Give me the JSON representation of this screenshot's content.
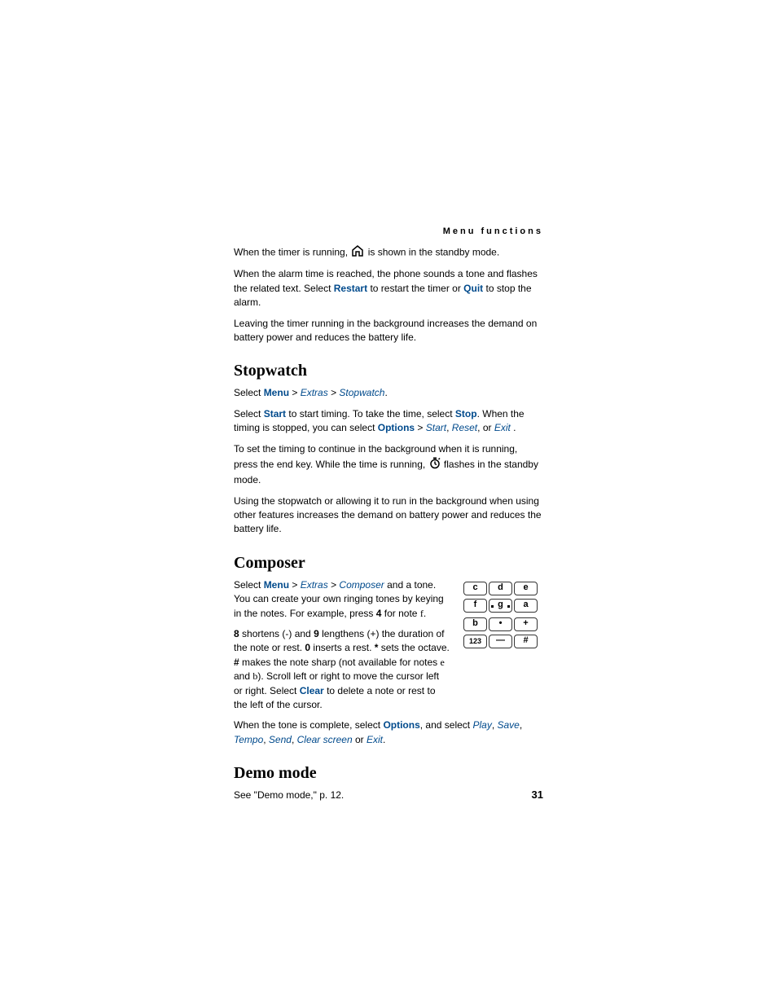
{
  "header": "Menu functions",
  "p1_a": "When the timer is running, ",
  "p1_b": " is shown in the standby mode.",
  "p2_a": "When the alarm time is reached, the phone sounds a tone and flashes the related text. Select ",
  "p2_restart": "Restart",
  "p2_b": " to restart the timer or ",
  "p2_quit": "Quit",
  "p2_c": " to stop the alarm.",
  "p3": "Leaving the timer running in the background increases the demand on battery power and reduces the battery life.",
  "h_stopwatch": "Stopwatch",
  "sw1_a": "Select ",
  "sw1_menu": "Menu",
  "sw1_gt1": " > ",
  "sw1_extras": "Extras",
  "sw1_gt2": " > ",
  "sw1_stopwatch": "Stopwatch",
  "sw1_period": ".",
  "sw2_a": "Select ",
  "sw2_start": "Start",
  "sw2_b": " to start timing. To take the time, select ",
  "sw2_stop": "Stop",
  "sw2_c": ". When the timing is stopped, you can select ",
  "sw2_options": "Options",
  "sw2_gt": " > ",
  "sw2_startit": "Start",
  "sw2_reset": "Reset",
  "sw2_exit": "Exit",
  "sw2_comma1": ", ",
  "sw2_or": ", or ",
  "sw2_space_period": " .",
  "sw3_a": "To set the timing to continue in the background when it is running, press the end key. While the time is running, ",
  "sw3_b": " flashes in the standby mode.",
  "sw4": "Using the stopwatch or allowing it to run in the background when using other features increases the demand on battery power and reduces the battery life.",
  "h_composer": "Composer",
  "c1_a": "Select ",
  "c1_menu": "Menu",
  "c1_gt1": " > ",
  "c1_extras": "Extras",
  "c1_gt2": " > ",
  "c1_composer": "Composer",
  "c1_b": " and a tone. You can create your own ringing tones by keying in the notes. For example, press ",
  "c1_4": "4",
  "c1_c": " for note ",
  "c1_f": "f",
  "c1_period": ".",
  "c2_8": "8",
  "c2_a": " shortens (-) and ",
  "c2_9": "9",
  "c2_b": " lengthens (+) the duration of the note or rest. ",
  "c2_0": "0",
  "c2_c": " inserts a rest. ",
  "c2_star": "*",
  "c2_d": " sets the octave. ",
  "c2_hash": "#",
  "c2_e": " makes the note sharp (not available for notes ",
  "c2_eletter": "e",
  "c2_f": " and ",
  "c2_bletter": "b",
  "c2_g": "). Scroll left or right to move the cursor left or right. Select ",
  "c2_clear": "Clear",
  "c2_h": " to delete a note or rest to the left of the cursor.",
  "c3_a": "When the tone is complete, select ",
  "c3_options": "Options",
  "c3_b": ", and select ",
  "c3_play": "Play",
  "c3_save": "Save",
  "c3_tempo": "Tempo",
  "c3_send": "Send",
  "c3_clearscreen": "Clear screen",
  "c3_exit": "Exit",
  "c3_comma": ", ",
  "c3_or": " or ",
  "c3_period": ".",
  "h_demo": "Demo mode",
  "demo_p": "See \"Demo mode,\" p. 12.",
  "keys": {
    "r1": [
      "c",
      "d",
      "e"
    ],
    "r2": [
      "f",
      "g",
      "a"
    ],
    "r3": [
      "b",
      "•",
      "+"
    ],
    "r4": [
      "123",
      "—",
      "#"
    ]
  },
  "page_number": "31"
}
